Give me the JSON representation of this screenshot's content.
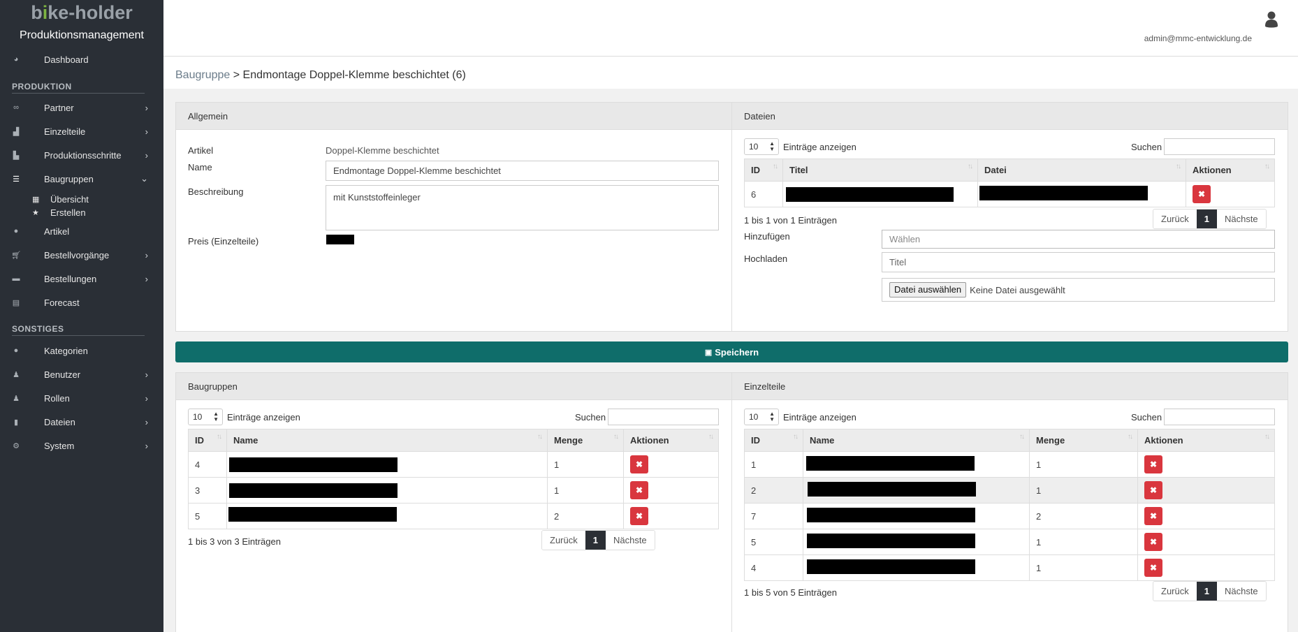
{
  "app": {
    "logo": {
      "b": "b",
      "i": "i",
      "rest": "ke-holder"
    },
    "subtitle": "Produktionsmanagement"
  },
  "sidebar": {
    "dashboard": "Dashboard",
    "section_produktion": "PRODUKTION",
    "partner": "Partner",
    "einzelteile": "Einzelteile",
    "produktionsschritte": "Produktionsschritte",
    "baugruppen": "Baugruppen",
    "uebersicht": "Übersicht",
    "erstellen": "Erstellen",
    "artikel": "Artikel",
    "bestellvorgaenge": "Bestellvorgänge",
    "bestellungen": "Bestellungen",
    "forecast": "Forecast",
    "section_sonstiges": "SONSTIGES",
    "kategorien": "Kategorien",
    "benutzer": "Benutzer",
    "rollen": "Rollen",
    "dateien": "Dateien",
    "system": "System"
  },
  "header": {
    "email": "admin@mmc-entwicklung.de"
  },
  "breadcrumb": {
    "link": "Baugruppe",
    "sep": " > ",
    "current": "Endmontage Doppel-Klemme beschichtet (6)"
  },
  "allgemein": {
    "title": "Allgemein",
    "artikel_label": "Artikel",
    "artikel_value": "Doppel-Klemme beschichtet",
    "name_label": "Name",
    "name_value": "Endmontage Doppel-Klemme beschichtet",
    "beschreibung_label": "Beschreibung",
    "beschreibung_value": "mit Kunststoffeinleger",
    "preis_label": "Preis (Einzelteile)"
  },
  "dateien": {
    "title": "Dateien",
    "length": "10",
    "length_label": "Einträge anzeigen",
    "search_label": "Suchen",
    "columns": [
      "ID",
      "Titel",
      "Datei",
      "Aktionen"
    ],
    "rows": [
      {
        "id": "6"
      }
    ],
    "info": "1 bis 1 von 1 Einträgen",
    "hinzufuegen_label": "Hinzufügen",
    "waehlen_placeholder": "Wählen",
    "hochladen_label": "Hochladen",
    "titel_placeholder": "Titel",
    "file_button": "Datei auswählen",
    "file_status": "Keine Datei ausgewählt"
  },
  "save_button": "Speichern",
  "baugruppen": {
    "title": "Baugruppen",
    "length": "10",
    "length_label": "Einträge anzeigen",
    "search_label": "Suchen",
    "columns": [
      "ID",
      "Name",
      "Menge",
      "Aktionen"
    ],
    "rows": [
      {
        "id": "4",
        "menge": "1"
      },
      {
        "id": "3",
        "menge": "1"
      },
      {
        "id": "5",
        "menge": "2"
      }
    ],
    "info": "1 bis 3 von 3 Einträgen"
  },
  "einzelteile": {
    "title": "Einzelteile",
    "length": "10",
    "length_label": "Einträge anzeigen",
    "search_label": "Suchen",
    "columns": [
      "ID",
      "Name",
      "Menge",
      "Aktionen"
    ],
    "rows": [
      {
        "id": "1",
        "menge": "1"
      },
      {
        "id": "2",
        "menge": "1"
      },
      {
        "id": "7",
        "menge": "2"
      },
      {
        "id": "5",
        "menge": "1"
      },
      {
        "id": "4",
        "menge": "1"
      }
    ],
    "info": "1 bis 5 von 5 Einträgen"
  },
  "pager": {
    "prev": "Zurück",
    "page": "1",
    "next": "Nächste"
  },
  "colors": {
    "sidebar": "#2a2f36",
    "accent": "#0f6d6a",
    "delete": "#d9363e",
    "logo_i": "#7db442"
  }
}
